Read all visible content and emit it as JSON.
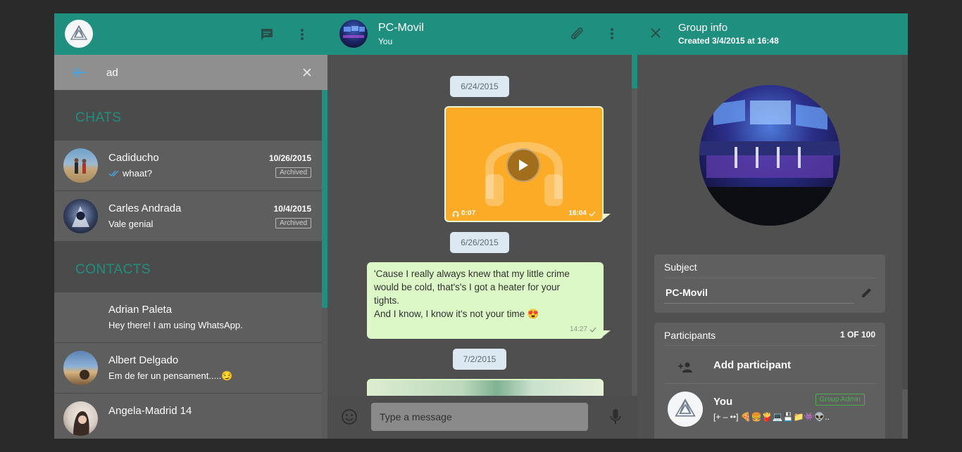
{
  "colors": {
    "accent": "#1f8f7f",
    "bubble_out": "#dcf8c6",
    "audio": "#fbab26",
    "panel": "#505050"
  },
  "left": {
    "header": {
      "icons": [
        "new-chat-icon",
        "menu-icon"
      ]
    },
    "search": {
      "value": "ad",
      "back_icon": "arrow-left-icon",
      "clear_icon": "close-icon"
    },
    "chats_title": "CHATS",
    "chats": [
      {
        "name": "Cadiducho",
        "date": "10/26/2015",
        "message": "whaat?",
        "status": "double-check-icon",
        "badge": "Archived"
      },
      {
        "name": "Carles Andrada",
        "date": "10/4/2015",
        "message": "Vale genial",
        "badge": "Archived"
      }
    ],
    "contacts_title": "CONTACTS",
    "contacts": [
      {
        "name": "Adrian Paleta",
        "message": "Hey there! I am using WhatsApp."
      },
      {
        "name": "Albert Delgado",
        "message": "Em de fer un pensament.....😏"
      },
      {
        "name": "Angela-Madrid 14"
      }
    ]
  },
  "chat": {
    "title": "PC-Movil",
    "subtitle": "You",
    "messages": {
      "date1": "6/24/2015",
      "audio": {
        "duration": "0:07",
        "time": "16:04"
      },
      "date2": "6/26/2015",
      "text": {
        "body_line1": "'Cause I really always knew that my little crime",
        "body_line2": "would be cold, that's's I got a heater for your",
        "body_line3": "tights.",
        "body_line4": "And I know, I know it's not your time 😍",
        "time": "14:27"
      },
      "date3": "7/2/2015"
    },
    "composer": {
      "placeholder": "Type a message"
    }
  },
  "info": {
    "title": "Group info",
    "created": "Created 3/4/2015 at 16:48",
    "subject_label": "Subject",
    "subject_value": "PC-Movil",
    "participants_label": "Participants",
    "participants_count": "1 OF 100",
    "add_participant": "Add participant",
    "member": {
      "name": "You",
      "badge": "Group Admin",
      "status": "[+ – ••] 🍕🍔🍟💻💾📁👾👽.."
    }
  }
}
